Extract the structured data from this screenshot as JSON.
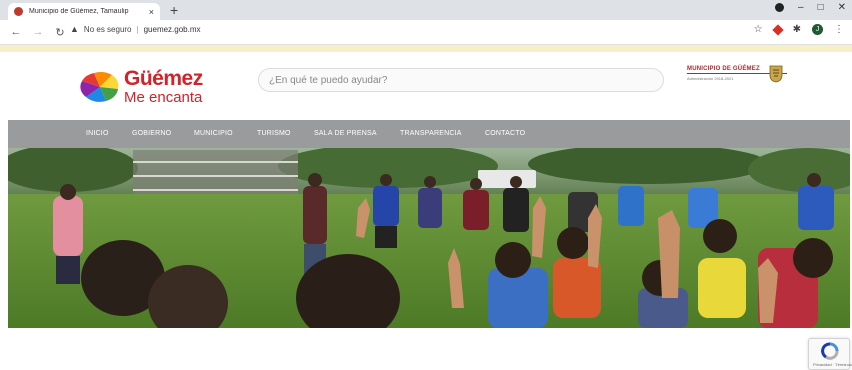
{
  "browser": {
    "tab_title": "Municipio de Güémez, Tamaulip",
    "tab_close": "×",
    "new_tab": "+",
    "address_security": "No es seguro",
    "address_url": "guemez.gob.mx",
    "profile_initial": "J",
    "icons": [
      "back-arrow-icon",
      "forward-arrow-icon",
      "reload-icon",
      "warning-icon",
      "star-icon",
      "extension-icon",
      "puzzle-icon",
      "menu-dots-icon",
      "minimize-icon",
      "maximize-icon",
      "close-icon"
    ]
  },
  "site": {
    "logo_line1": "Güémez",
    "logo_line2": "Me encanta",
    "search_placeholder": "¿En qué te puedo ayudar?",
    "municipio_name": "MUNICIPIO DE GÜÉMEZ",
    "municipio_sub": "Administración 2018-2021",
    "brand_color": "#d2232a",
    "nav_color": "#9a9b9d"
  },
  "nav": {
    "items": [
      "INICIO",
      "GOBIERNO",
      "MUNICIPIO",
      "TURISMO",
      "SALA DE PRENSA",
      "TRANSPARENCIA",
      "CONTACTO"
    ]
  },
  "hero": {
    "description": "photo-of-children-on-soccer-field"
  },
  "recaptcha": {
    "label": "Privacidad · Términos"
  }
}
